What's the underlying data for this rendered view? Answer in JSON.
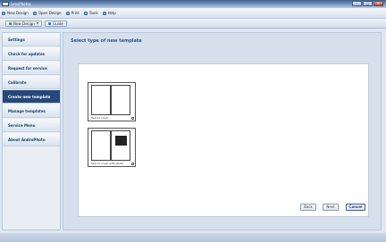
{
  "window": {
    "title": "LensPhotos",
    "controls": {
      "minimize": "–",
      "maximize": "□",
      "close": "✕"
    }
  },
  "menubar": {
    "items": [
      {
        "label": "New Design",
        "icon": "new-document-icon"
      },
      {
        "label": "Open Design",
        "icon": "folder-icon"
      },
      {
        "label": "Print",
        "icon": "printer-icon"
      },
      {
        "label": "Tools",
        "icon": "wrench-icon"
      },
      {
        "label": "Help",
        "icon": "help-icon"
      }
    ]
  },
  "toolbar": {
    "new_design_label": "New Design",
    "guide_label": "Guide"
  },
  "sidebar": {
    "items": [
      {
        "label": "Settings"
      },
      {
        "label": "Check for updates"
      },
      {
        "label": "Request for service"
      },
      {
        "label": "Calibrate"
      },
      {
        "label": "Create new template",
        "active": true
      },
      {
        "label": "Manage templates"
      },
      {
        "label": "Service Menu"
      },
      {
        "label": "About AndroPhoto"
      }
    ]
  },
  "main": {
    "title": "Select type of new template",
    "templates": [
      {
        "caption": "Text to cover"
      },
      {
        "caption": "Text to cover with photo"
      }
    ],
    "buttons": {
      "back": "Back",
      "next": "Next",
      "cancel": "Cancel"
    }
  },
  "colors": {
    "active_sidebar": "#27467a",
    "title_text": "#2c4f86",
    "content_background": "#d6e0ec"
  }
}
